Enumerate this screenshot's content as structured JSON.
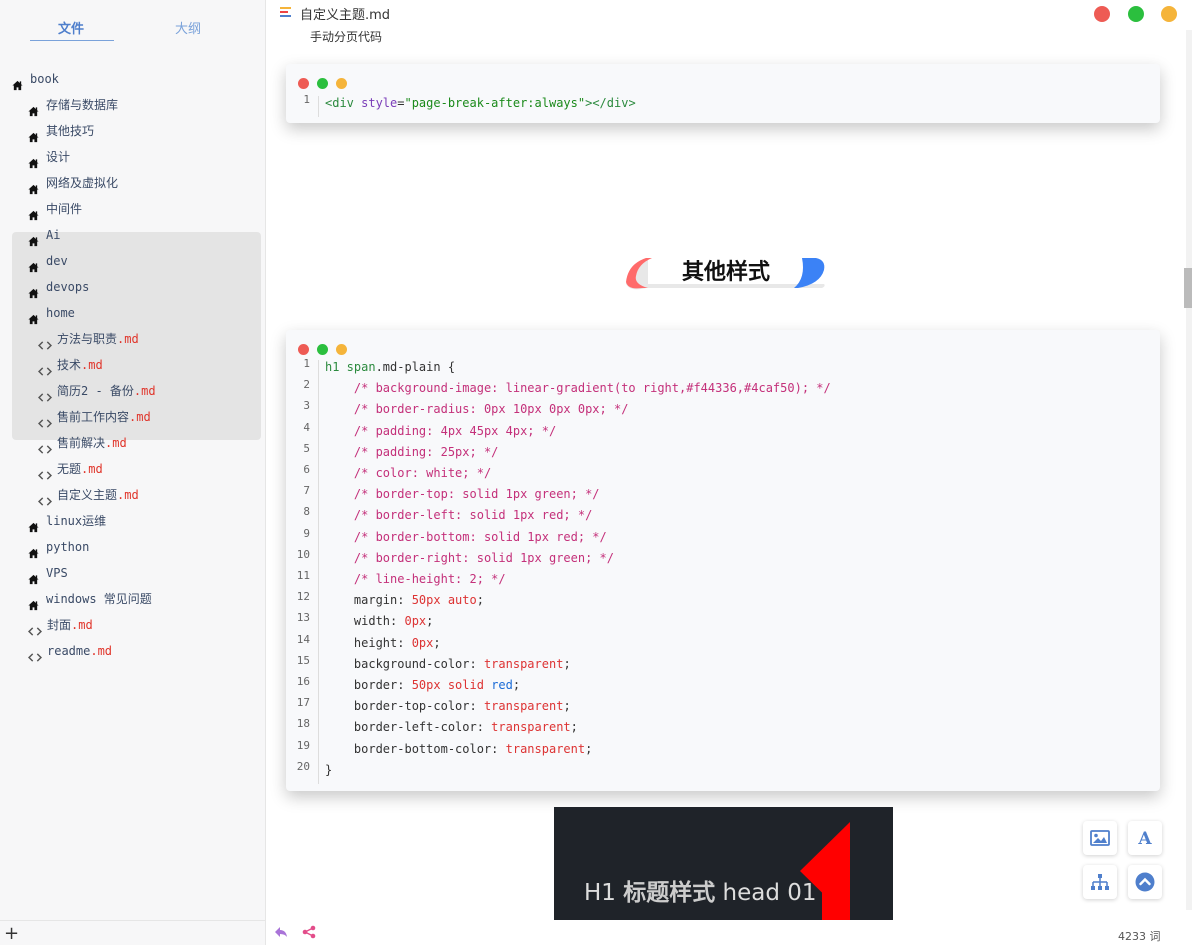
{
  "sidebar": {
    "tabs": [
      {
        "label": "文件",
        "active": true
      },
      {
        "label": "大纲",
        "active": false
      }
    ],
    "tree": [
      {
        "label": "book",
        "type": "folder",
        "level": 0
      },
      {
        "label": "存储与数据库",
        "type": "folder",
        "level": 1
      },
      {
        "label": "其他技巧",
        "type": "folder",
        "level": 1
      },
      {
        "label": "设计",
        "type": "folder",
        "level": 1
      },
      {
        "label": "网络及虚拟化",
        "type": "folder",
        "level": 1
      },
      {
        "label": "中间件",
        "type": "folder",
        "level": 1
      },
      {
        "label": "Ai",
        "type": "folder",
        "level": 1
      },
      {
        "label": "dev",
        "type": "folder",
        "level": 1
      },
      {
        "label": "devops",
        "type": "folder",
        "level": 1
      },
      {
        "label": "home",
        "type": "folder",
        "level": 1
      },
      {
        "label": "方法与职责",
        "ext": ".md",
        "type": "file",
        "level": 2
      },
      {
        "label": "技术",
        "ext": ".md",
        "type": "file",
        "level": 2
      },
      {
        "label": "简历2 - 备份",
        "ext": ".md",
        "type": "file",
        "level": 2
      },
      {
        "label": "售前工作内容",
        "ext": ".md",
        "type": "file",
        "level": 2
      },
      {
        "label": "售前解决",
        "ext": ".md",
        "type": "file",
        "level": 2
      },
      {
        "label": "无题",
        "ext": ".md",
        "type": "file",
        "level": 2
      },
      {
        "label": "自定义主题",
        "ext": ".md",
        "type": "file",
        "level": 2
      },
      {
        "label": "linux运维",
        "type": "folder",
        "level": 1
      },
      {
        "label": "python",
        "type": "folder",
        "level": 1
      },
      {
        "label": "VPS",
        "type": "folder",
        "level": 1
      },
      {
        "label": "windows 常见问题",
        "type": "folder",
        "level": 1
      },
      {
        "label": "封面",
        "ext": ".md",
        "type": "file",
        "level": 1
      },
      {
        "label": "readme",
        "ext": ".md",
        "type": "file",
        "level": 1
      }
    ],
    "add_label": "+"
  },
  "document": {
    "file_name": "自定义主题.md",
    "subtext": "手动分页代码",
    "heading": "其他样式",
    "code_block_1": [
      [
        {
          "t": "<div ",
          "c": "c-tag"
        },
        {
          "t": "style",
          "c": "c-attr"
        },
        {
          "t": "=",
          "c": ""
        },
        {
          "t": "\"page-break-after:always\"",
          "c": "c-str"
        },
        {
          "t": "></div>",
          "c": "c-tag"
        }
      ]
    ],
    "code_block_2": [
      [
        {
          "t": "h1 span",
          "c": "c-tag"
        },
        {
          "t": ".md-plain {",
          "c": ""
        }
      ],
      [
        {
          "t": "    /* background-image: linear-gradient(to right,#f44336,#4caf50); */",
          "c": "c-com"
        }
      ],
      [
        {
          "t": "    /* border-radius: 0px 10px 0px 0px; */",
          "c": "c-com"
        }
      ],
      [
        {
          "t": "    /* padding: 4px 45px 4px; */",
          "c": "c-com"
        }
      ],
      [
        {
          "t": "    /* padding: 25px; */",
          "c": "c-com"
        }
      ],
      [
        {
          "t": "    /* color: white; */",
          "c": "c-com"
        }
      ],
      [
        {
          "t": "    /* border-top: solid 1px green; */",
          "c": "c-com"
        }
      ],
      [
        {
          "t": "    /* border-left: solid 1px red; */",
          "c": "c-com"
        }
      ],
      [
        {
          "t": "    /* border-bottom: solid 1px red; */",
          "c": "c-com"
        }
      ],
      [
        {
          "t": "    /* border-right: solid 1px green; */",
          "c": "c-com"
        }
      ],
      [
        {
          "t": "    /* line-height: 2; */",
          "c": "c-com"
        }
      ],
      [
        {
          "t": "    margin: ",
          "c": ""
        },
        {
          "t": "50px auto",
          "c": "c-val"
        },
        {
          "t": ";",
          "c": ""
        }
      ],
      [
        {
          "t": "    width: ",
          "c": ""
        },
        {
          "t": "0px",
          "c": "c-val"
        },
        {
          "t": ";",
          "c": ""
        }
      ],
      [
        {
          "t": "    height: ",
          "c": ""
        },
        {
          "t": "0px",
          "c": "c-val"
        },
        {
          "t": ";",
          "c": ""
        }
      ],
      [
        {
          "t": "    background-color: ",
          "c": ""
        },
        {
          "t": "transparent",
          "c": "c-val"
        },
        {
          "t": ";",
          "c": ""
        }
      ],
      [
        {
          "t": "    border: ",
          "c": ""
        },
        {
          "t": "50px solid ",
          "c": "c-val"
        },
        {
          "t": "red",
          "c": "c-kw"
        },
        {
          "t": ";",
          "c": ""
        }
      ],
      [
        {
          "t": "    border-top-color: ",
          "c": ""
        },
        {
          "t": "transparent",
          "c": "c-val"
        },
        {
          "t": ";",
          "c": ""
        }
      ],
      [
        {
          "t": "    border-left-color: ",
          "c": ""
        },
        {
          "t": "transparent",
          "c": "c-val"
        },
        {
          "t": ";",
          "c": ""
        }
      ],
      [
        {
          "t": "    border-bottom-color: ",
          "c": ""
        },
        {
          "t": "transparent",
          "c": "c-val"
        },
        {
          "t": ";",
          "c": ""
        }
      ],
      [
        {
          "t": "}",
          "c": ""
        }
      ]
    ],
    "preview": {
      "prefix": "H1 ",
      "bold": "标题样式",
      "suffix": " head 01"
    }
  },
  "status": {
    "word_count": "4233 词"
  },
  "colors": {
    "close": "#ee5b54",
    "maximize": "#2bbf3e",
    "minimize": "#f5b43a",
    "accent": "#4f7fcc"
  }
}
